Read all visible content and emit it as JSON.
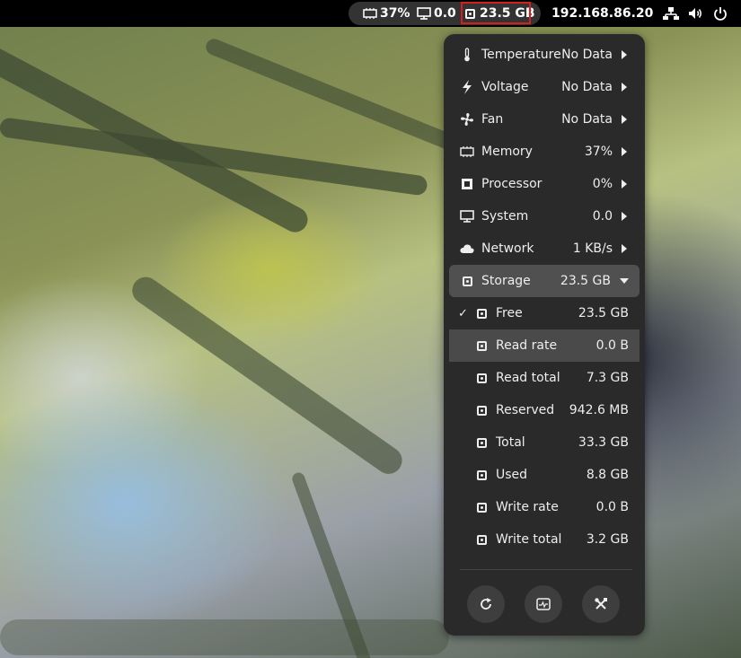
{
  "topbar": {
    "indicators": {
      "memory": "37%",
      "system": "0.0",
      "storage": "23.5 GB"
    },
    "ip_address": "192.168.86.20"
  },
  "menu": {
    "items": [
      {
        "label": "Temperature",
        "value": "No Data",
        "icon": "thermometer-icon"
      },
      {
        "label": "Voltage",
        "value": "No Data",
        "icon": "lightning-icon"
      },
      {
        "label": "Fan",
        "value": "No Data",
        "icon": "fan-icon"
      },
      {
        "label": "Memory",
        "value": "37%",
        "icon": "memory-icon"
      },
      {
        "label": "Processor",
        "value": "0%",
        "icon": "processor-icon"
      },
      {
        "label": "System",
        "value": "0.0",
        "icon": "monitor-icon"
      },
      {
        "label": "Network",
        "value": "1 KB/s",
        "icon": "cloud-icon"
      },
      {
        "label": "Storage",
        "value": "23.5 GB",
        "icon": "disk-icon"
      }
    ],
    "storage_submenu": [
      {
        "label": "Free",
        "value": "23.5 GB",
        "checked": true
      },
      {
        "label": "Read rate",
        "value": "0.0 B",
        "checked": false
      },
      {
        "label": "Read total",
        "value": "7.3 GB",
        "checked": false
      },
      {
        "label": "Reserved",
        "value": "942.6 MB",
        "checked": false
      },
      {
        "label": "Total",
        "value": "33.3 GB",
        "checked": false
      },
      {
        "label": "Used",
        "value": "8.8 GB",
        "checked": false
      },
      {
        "label": "Write rate",
        "value": "0.0 B",
        "checked": false
      },
      {
        "label": "Write total",
        "value": "3.2 GB",
        "checked": false
      }
    ],
    "check_mark": "✓",
    "buttons": [
      "refresh-icon",
      "system-monitor-icon",
      "preferences-icon"
    ]
  }
}
